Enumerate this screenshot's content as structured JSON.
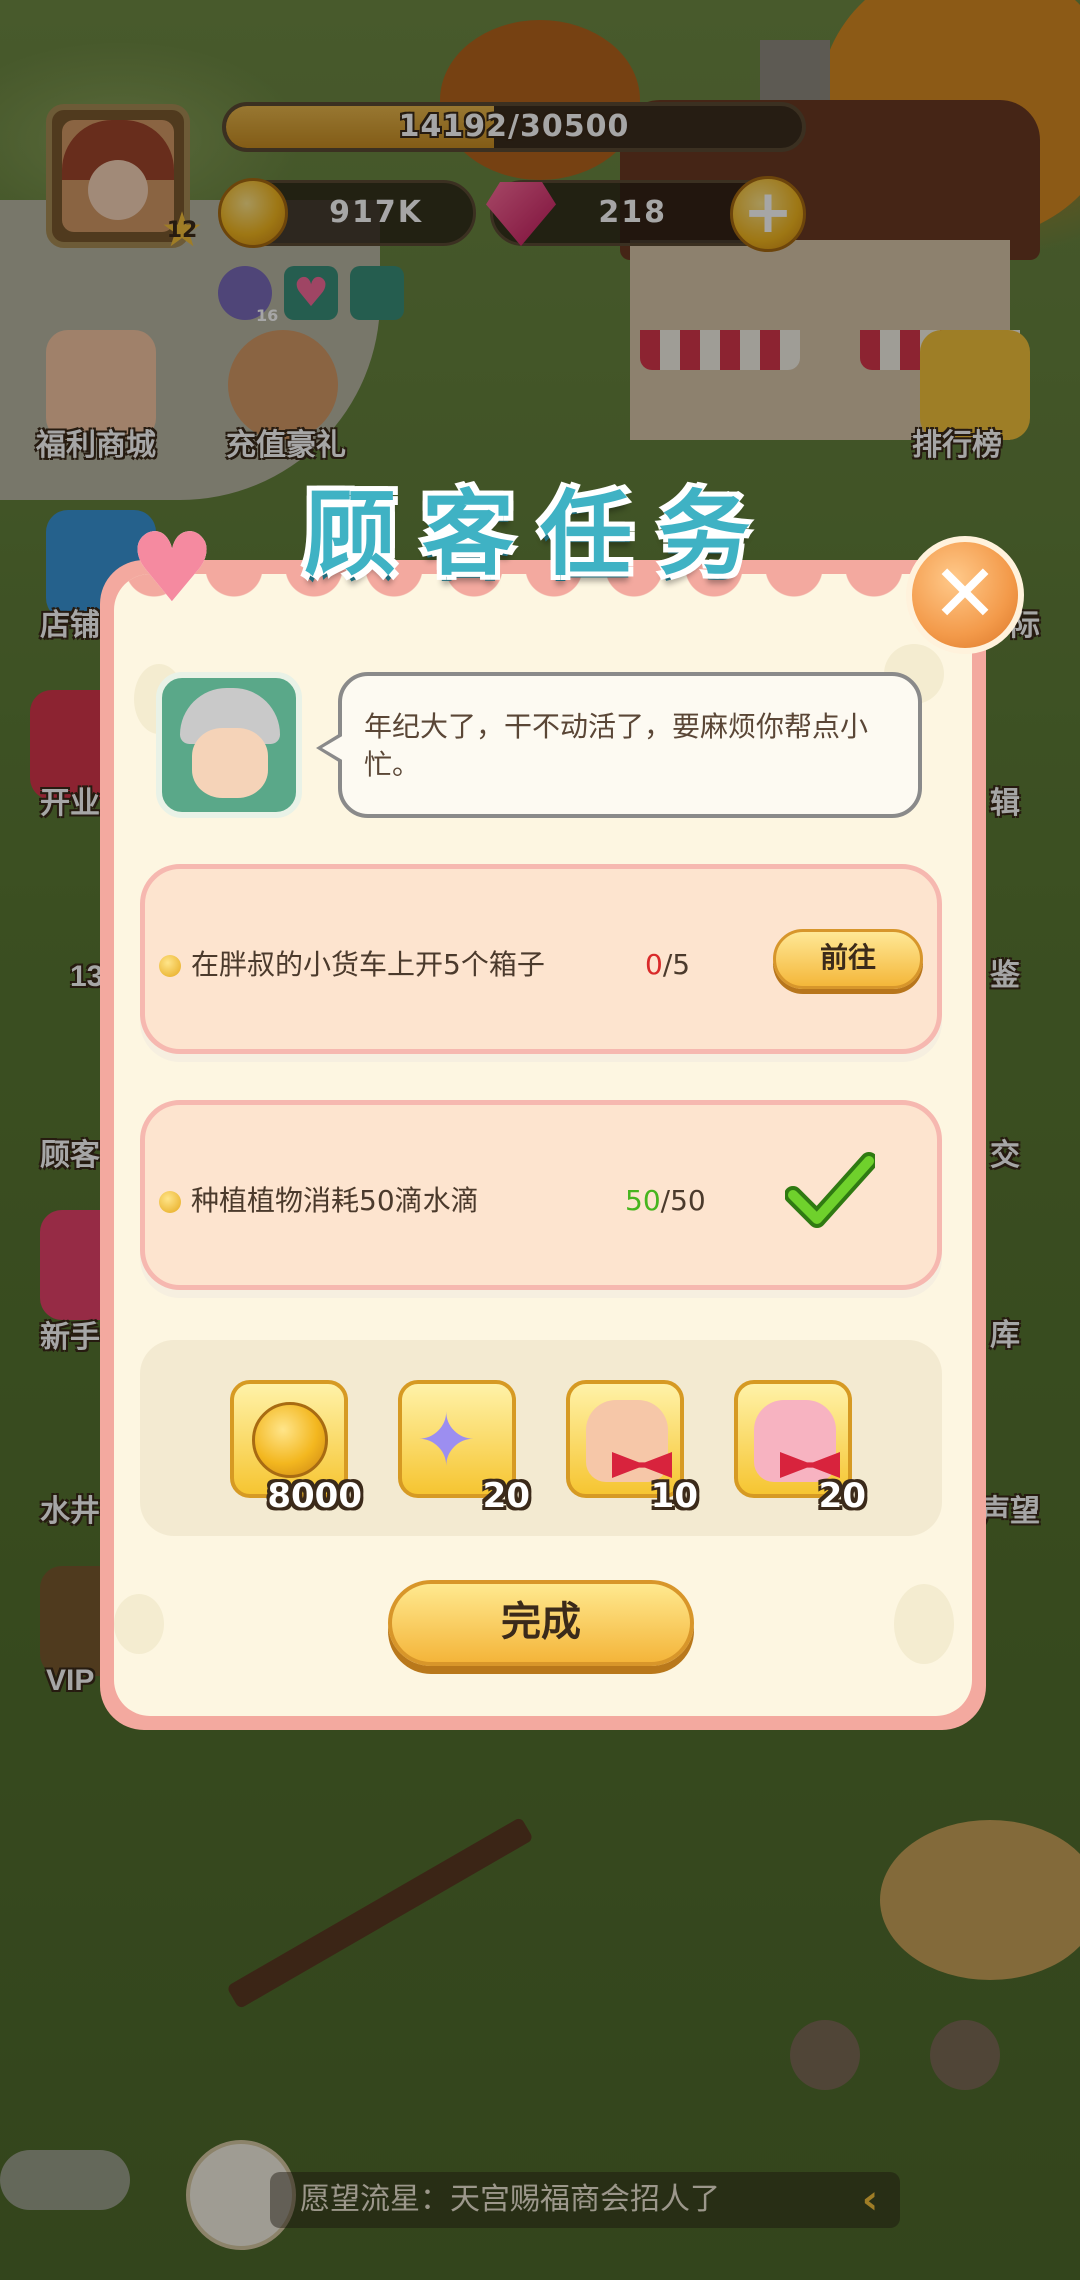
{
  "hud": {
    "level": "12",
    "exp_text": "14192/30500",
    "exp_fraction": 0.465,
    "coins": "917K",
    "gems": "218",
    "buff_count": "16"
  },
  "side_left": [
    "福利商城",
    "充值豪礼",
    "店铺",
    "开业",
    "13",
    "顾客",
    "新手",
    "水井",
    "VIP"
  ],
  "side_right": [
    "排行榜",
    "际",
    "辑",
    "鉴",
    "交",
    "库",
    "声望"
  ],
  "dialog": {
    "title": "顾客任务",
    "npc_speech": "年纪大了，干不动活了，要麻烦你帮点小忙。",
    "tasks": [
      {
        "text": "在胖叔的小货车上开5个箱子",
        "current": "0",
        "total": "/5",
        "action": "前往",
        "completed": false
      },
      {
        "text": "种植植物消耗50滴水滴",
        "current": "50",
        "total": "/50",
        "completed": true
      }
    ],
    "rewards": [
      {
        "icon": "coin-icon",
        "count": "8000"
      },
      {
        "icon": "magic-wand-icon",
        "count": "20"
      },
      {
        "icon": "mystery-bag-icon",
        "count": "10"
      },
      {
        "icon": "gift-bag-icon",
        "count": "20"
      }
    ],
    "complete_label": "完成"
  },
  "ticker": {
    "text": "愿望流星：天宫赐福商会招人了"
  },
  "colors": {
    "title": "#3fb2c4",
    "progress_incomplete": "#d92a2a",
    "progress_complete": "#47b51f"
  }
}
